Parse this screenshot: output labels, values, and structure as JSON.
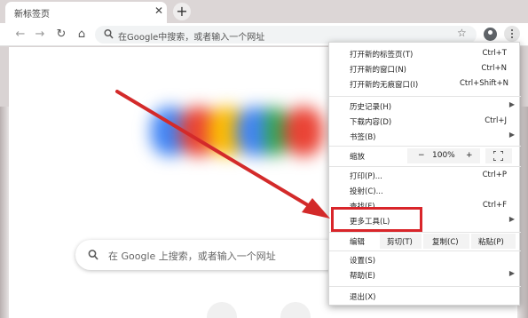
{
  "tab": {
    "title": "新标签页",
    "close_icon": "close-icon"
  },
  "toolbar": {
    "omnibox_placeholder": "在Google中搜索，或者输入一个网址",
    "icons": [
      "back-icon",
      "forward-icon",
      "reload-icon",
      "home-icon",
      "search-icon",
      "star-icon",
      "account-icon",
      "menu-kebab-icon"
    ]
  },
  "page": {
    "search_placeholder": "在 Google 上搜索，或者输入一个网址",
    "logo_colors": [
      "#4285f4",
      "#ea4335",
      "#fbbc05",
      "#4285f4",
      "#34a853",
      "#ea4335"
    ]
  },
  "menu": {
    "new_tab": {
      "label": "打开新的标签页(T)",
      "shortcut": "Ctrl+T"
    },
    "new_window": {
      "label": "打开新的窗口(N)",
      "shortcut": "Ctrl+N"
    },
    "new_incognito": {
      "label": "打开新的无痕窗口(I)",
      "shortcut": "Ctrl+Shift+N"
    },
    "history": {
      "label": "历史记录(H)"
    },
    "downloads": {
      "label": "下载内容(D)",
      "shortcut": "Ctrl+J"
    },
    "bookmarks": {
      "label": "书签(B)"
    },
    "zoom": {
      "label": "缩放",
      "minus": "−",
      "value": "100%",
      "plus": "+"
    },
    "print": {
      "label": "打印(P)...",
      "shortcut": "Ctrl+P"
    },
    "cast": {
      "label": "投射(C)..."
    },
    "find": {
      "label": "查找(F)...",
      "shortcut": "Ctrl+F"
    },
    "more_tools": {
      "label": "更多工具(L)"
    },
    "edit": {
      "label": "编辑",
      "cut": "剪切(T)",
      "copy": "复制(C)",
      "paste": "粘贴(P)"
    },
    "settings": {
      "label": "设置(S)"
    },
    "help": {
      "label": "帮助(E)"
    },
    "exit": {
      "label": "退出(X)"
    }
  },
  "annotation": {
    "highlight_color": "#d9252a"
  }
}
